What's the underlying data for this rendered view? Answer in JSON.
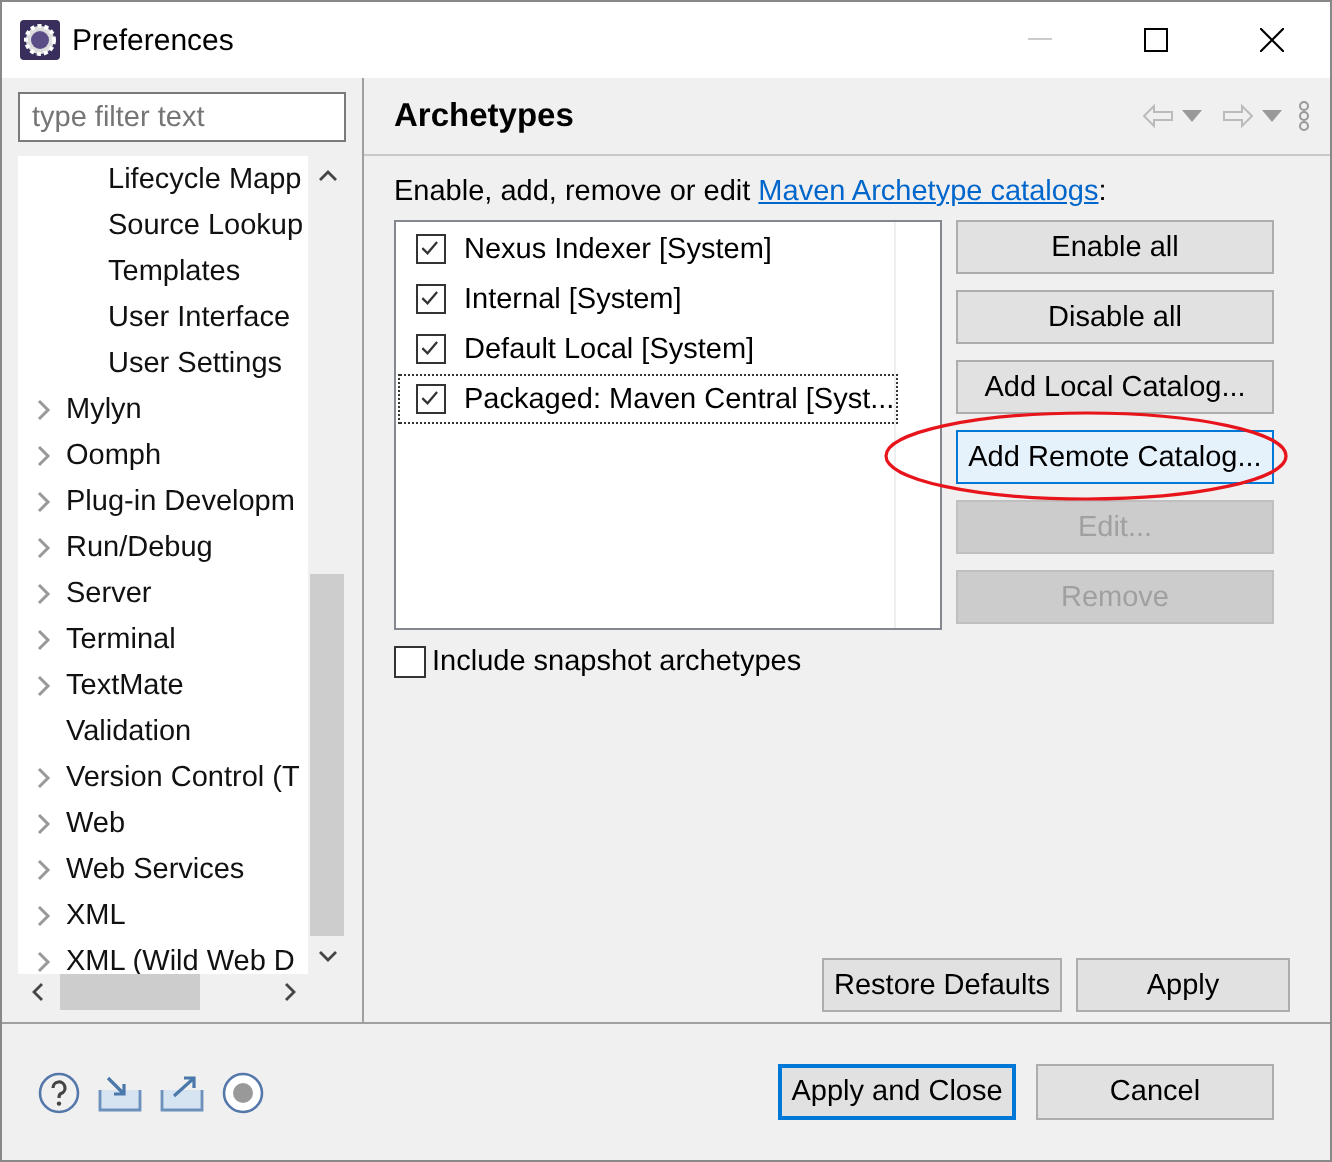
{
  "window": {
    "title": "Preferences"
  },
  "filter": {
    "placeholder": "type filter text"
  },
  "tree": {
    "continued_children": [
      {
        "label": "Lifecycle Mapp"
      },
      {
        "label": "Source Lookup"
      },
      {
        "label": "Templates"
      },
      {
        "label": "User Interface"
      },
      {
        "label": "User Settings"
      }
    ],
    "items": [
      {
        "label": "Mylyn",
        "expandable": true
      },
      {
        "label": "Oomph",
        "expandable": true
      },
      {
        "label": "Plug-in Developm",
        "expandable": true
      },
      {
        "label": "Run/Debug",
        "expandable": true
      },
      {
        "label": "Server",
        "expandable": true
      },
      {
        "label": "Terminal",
        "expandable": true
      },
      {
        "label": "TextMate",
        "expandable": true
      },
      {
        "label": "Validation",
        "expandable": false
      },
      {
        "label": "Version Control (T",
        "expandable": true
      },
      {
        "label": "Web",
        "expandable": true
      },
      {
        "label": "Web Services",
        "expandable": true
      },
      {
        "label": "XML",
        "expandable": true
      },
      {
        "label": "XML (Wild Web D",
        "expandable": true
      }
    ]
  },
  "page": {
    "title": "Archetypes",
    "description": {
      "before": "Enable, add, remove or edit ",
      "link": "Maven Archetype catalogs",
      "after": ":"
    },
    "catalogs": [
      {
        "label": "Nexus Indexer [System]",
        "checked": true,
        "selected": false
      },
      {
        "label": "Internal [System]",
        "checked": true,
        "selected": false
      },
      {
        "label": "Default Local [System]",
        "checked": true,
        "selected": false
      },
      {
        "label": "Packaged: Maven Central [Syst...",
        "checked": true,
        "selected": true
      }
    ],
    "buttons": [
      {
        "label": "Enable all",
        "disabled": false,
        "highlighted": false
      },
      {
        "label": "Disable all",
        "disabled": false,
        "highlighted": false
      },
      {
        "label": "Add Local Catalog...",
        "disabled": false,
        "highlighted": false
      },
      {
        "label": "Add Remote Catalog...",
        "disabled": false,
        "highlighted": true
      },
      {
        "label": "Edit...",
        "disabled": true,
        "highlighted": false
      },
      {
        "label": "Remove",
        "disabled": true,
        "highlighted": false
      }
    ],
    "snapshot": {
      "label": "Include snapshot archetypes",
      "checked": false
    },
    "page_buttons": [
      "Restore Defaults",
      "Apply"
    ]
  },
  "footer_buttons": [
    {
      "label": "Apply and Close",
      "default": true
    },
    {
      "label": "Cancel",
      "default": false
    }
  ]
}
